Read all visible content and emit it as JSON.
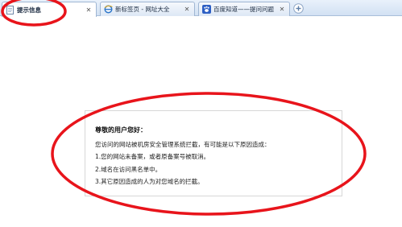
{
  "tabs": [
    {
      "label": "提示信息",
      "close": "✕",
      "active": true,
      "icon": "page-icon"
    },
    {
      "label": "新标签页 - 网址大全",
      "close": "✕",
      "active": false,
      "icon": "ie-icon"
    },
    {
      "label": "百度知道——提问问题",
      "close": "✕",
      "active": false,
      "icon": "paw-icon"
    }
  ],
  "new_tab_icon": "plus-icon",
  "message": {
    "title": "尊敬的用户您好：",
    "lines": [
      "您访问的网站被机房安全管理系统拦截，有可能是以下原因造成：",
      "1.您的网站未备案，或者原备案号被取消。",
      "2.域名在访问黑名单中。",
      "3.其它原因造成的人为对您域名的拦截。"
    ]
  },
  "annotation_color": "#e8141b"
}
